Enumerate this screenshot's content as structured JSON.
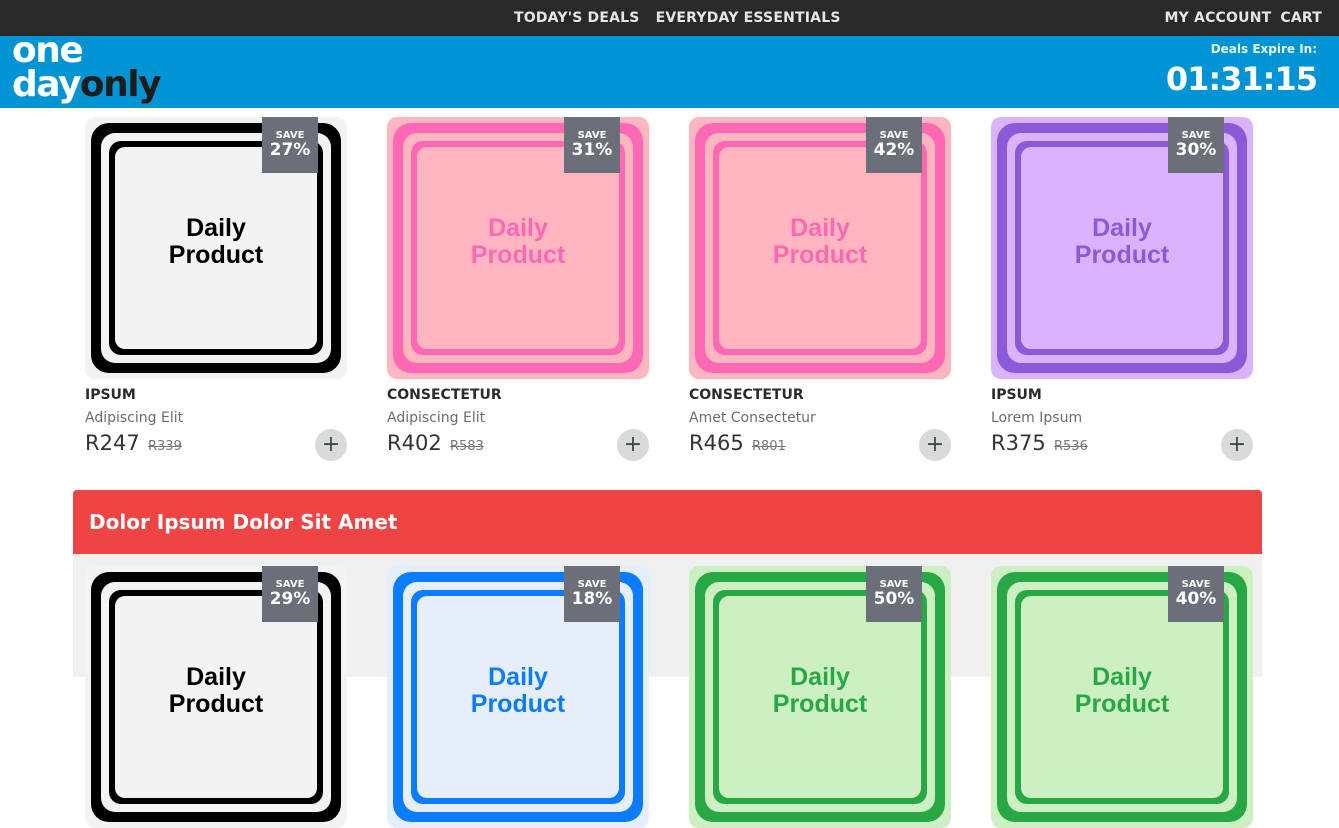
{
  "topbar": {
    "nav": [
      "TODAY'S DEALS",
      "EVERYDAY ESSENTIALS"
    ],
    "account": "MY ACCOUNT",
    "cart": "CART"
  },
  "header": {
    "logo_one": "one",
    "logo_day": "day",
    "logo_only": "only",
    "expire_label": "Deals Expire In:",
    "countdown": "01:31:15"
  },
  "thumb_text": [
    "Daily",
    "Product"
  ],
  "row1": [
    {
      "save_label": "SAVE",
      "save": "27%",
      "brand": "IPSUM",
      "name": "Adipiscing Elit",
      "price": "R247",
      "was": "R339",
      "theme": "black"
    },
    {
      "save_label": "SAVE",
      "save": "31%",
      "brand": "CONSECTETUR",
      "name": "Adipiscing Elit",
      "price": "R402",
      "was": "R583",
      "theme": "pink"
    },
    {
      "save_label": "SAVE",
      "save": "42%",
      "brand": "CONSECTETUR",
      "name": "Amet Consectetur",
      "price": "R465",
      "was": "R801",
      "theme": "pink"
    },
    {
      "save_label": "SAVE",
      "save": "30%",
      "brand": "IPSUM",
      "name": "Lorem Ipsum",
      "price": "R375",
      "was": "R536",
      "theme": "purple"
    }
  ],
  "section_title": "Dolor Ipsum Dolor Sit Amet",
  "row2": [
    {
      "save_label": "SAVE",
      "save": "29%",
      "theme": "black"
    },
    {
      "save_label": "SAVE",
      "save": "18%",
      "theme": "blue"
    },
    {
      "save_label": "SAVE",
      "save": "50%",
      "theme": "green"
    },
    {
      "save_label": "SAVE",
      "save": "40%",
      "theme": "green"
    }
  ],
  "add_symbol": "+",
  "themes": {
    "black": {
      "bg": "#f3f3f3",
      "line": "#000000",
      "fill": "#f3f3f3",
      "text": "#000000"
    },
    "pink": {
      "bg": "#ffb6c1",
      "line": "#ff69b4",
      "fill": "#ffb6c1",
      "text": "#ff69b4"
    },
    "purple": {
      "bg": "#dab3ff",
      "line": "#8a5ad8",
      "fill": "#dab3ff",
      "text": "#8a5ad8"
    },
    "blue": {
      "bg": "#e7eefb",
      "line": "#0a7cff",
      "fill": "#e7eefb",
      "text": "#0a7cff"
    },
    "green": {
      "bg": "#ccf0c2",
      "line": "#28a745",
      "fill": "#ccf0c2",
      "text": "#28a745"
    }
  }
}
